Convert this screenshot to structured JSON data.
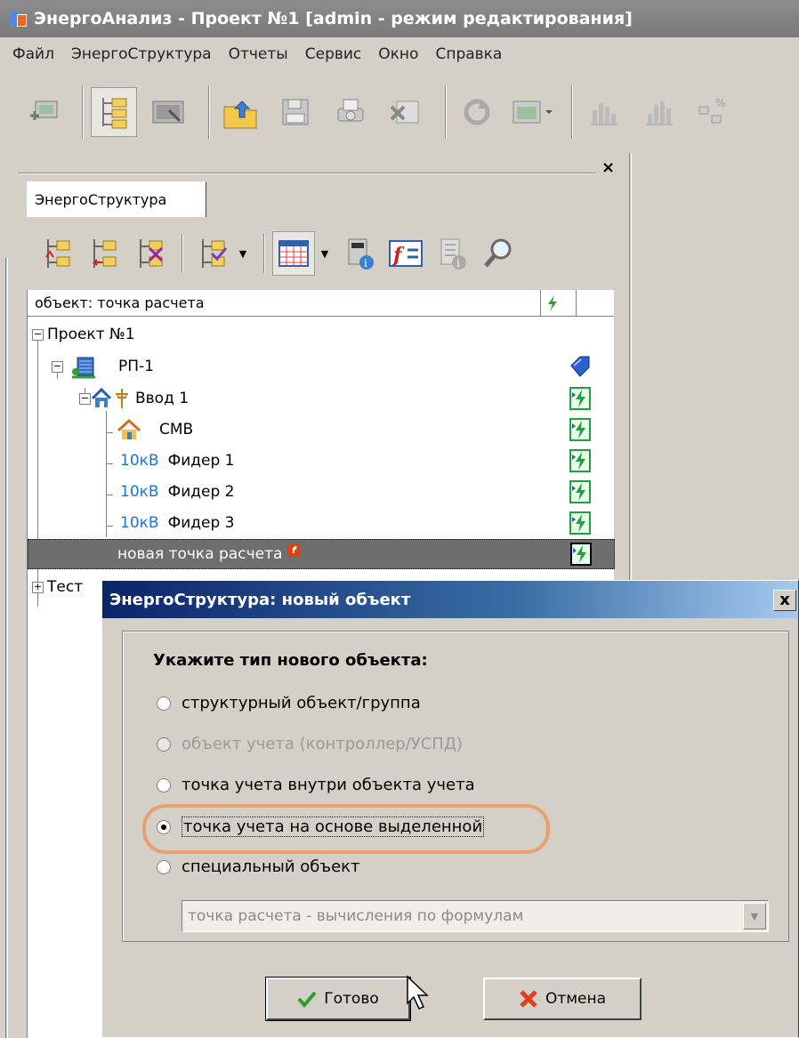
{
  "window": {
    "title": "ЭнергоАнализ - Проект №1 [admin - режим редактирования]"
  },
  "menu": [
    "Файл",
    "ЭнергоСтруктура",
    "Отчеты",
    "Сервис",
    "Окно",
    "Справка"
  ],
  "toolbar_icons": [
    "add-window-icon",
    "tree-view-icon",
    "console-icon",
    "upload-icon",
    "save-icon",
    "print-icon",
    "excel-icon",
    "refresh-icon",
    "table-dropdown-icon",
    "bar-chart-icon",
    "bar-chart-2-icon",
    "percent-chart-icon"
  ],
  "panel": {
    "tab_label": "ЭнергоСтруктура",
    "close_glyph": "×"
  },
  "tree": {
    "column_header": "объект: точка расчета",
    "items": [
      {
        "label": "Проект №1"
      },
      {
        "label": "РП-1"
      },
      {
        "label": "Ввод 1"
      },
      {
        "label": "СМВ"
      },
      {
        "prefix": "10кВ",
        "label": "Фидер 1"
      },
      {
        "prefix": "10кВ",
        "label": "Фидер 2"
      },
      {
        "prefix": "10кВ",
        "label": "Фидер 3"
      },
      {
        "label": "новая точка расчета",
        "badge": "f"
      },
      {
        "label": "Тест"
      }
    ]
  },
  "dialog": {
    "title": "ЭнергоСтруктура: новый объект",
    "close_glyph": "x",
    "heading": "Укажите тип нового объекта:",
    "options": [
      {
        "label": "структурный объект/группа"
      },
      {
        "label": "объект учета (контроллер/УСПД)"
      },
      {
        "label": "точка учета внутри объекта учета"
      },
      {
        "label": "точка учета на основе выделенной"
      },
      {
        "label": "специальный объект"
      }
    ],
    "selected_option": 3,
    "special_type_value": "точка расчета - вычисления по формулам",
    "ok_label": "Готово",
    "cancel_label": "Отмена",
    "colors": {
      "highlight": "#e8a070",
      "title_bar": "#0a246a"
    }
  }
}
